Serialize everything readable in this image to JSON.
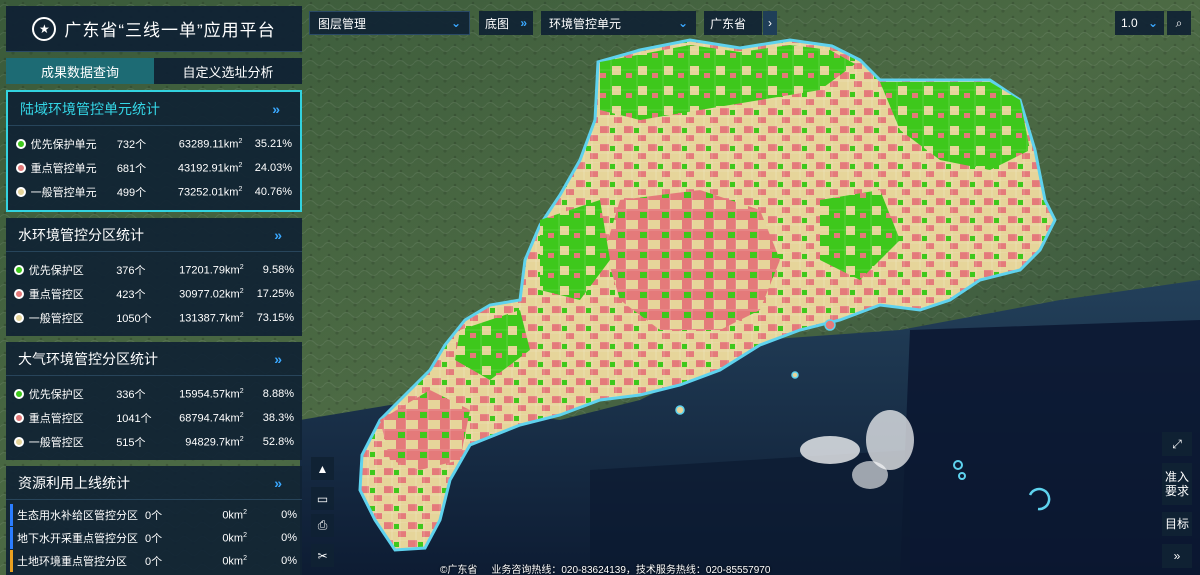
{
  "app_title": "广东省“三线一单”应用平台",
  "tabs": [
    "成果数据查询",
    "自定义选址分析"
  ],
  "colors": {
    "priority": "#3ec81c",
    "key": "#e47a7a",
    "general": "#e6d59a",
    "panel": "#102234",
    "accent": "#32d3e0"
  },
  "stats": [
    {
      "title": "陆域环境管控单元统计",
      "rows": [
        {
          "name": "优先保护单元",
          "count": "732个",
          "area": "63289.11km",
          "pct": "35.21%",
          "color": "#3ec81c"
        },
        {
          "name": "重点管控单元",
          "count": "681个",
          "area": "43192.91km",
          "pct": "24.03%",
          "color": "#e47a7a"
        },
        {
          "name": "一般管控单元",
          "count": "499个",
          "area": "73252.01km",
          "pct": "40.76%",
          "color": "#e6d59a"
        }
      ]
    },
    {
      "title": "水环境管控分区统计",
      "rows": [
        {
          "name": "优先保护区",
          "count": "376个",
          "area": "17201.79km",
          "pct": "9.58%",
          "color": "#3ec81c"
        },
        {
          "name": "重点管控区",
          "count": "423个",
          "area": "30977.02km",
          "pct": "17.25%",
          "color": "#e47a7a"
        },
        {
          "name": "一般管控区",
          "count": "1050个",
          "area": "131387.7km",
          "pct": "73.15%",
          "color": "#e6d59a"
        }
      ]
    },
    {
      "title": "大气环境管控分区统计",
      "rows": [
        {
          "name": "优先保护区",
          "count": "336个",
          "area": "15954.57km",
          "pct": "8.88%",
          "color": "#3ec81c"
        },
        {
          "name": "重点管控区",
          "count": "1041个",
          "area": "68794.74km",
          "pct": "38.3%",
          "color": "#e47a7a"
        },
        {
          "name": "一般管控区",
          "count": "515个",
          "area": "94829.7km",
          "pct": "52.8%",
          "color": "#e6d59a"
        }
      ]
    }
  ],
  "resource": {
    "title": "资源利用上线统计",
    "rows": [
      {
        "name": "生态用水补给区管控分区",
        "count": "0个",
        "area": "0km",
        "pct": "0%",
        "color": "#2b7dff"
      },
      {
        "name": "地下水开采重点管控分区",
        "count": "0个",
        "area": "0km",
        "pct": "0%",
        "color": "#2b7dff"
      },
      {
        "name": "土地环境重点管控分区",
        "count": "0个",
        "area": "0km",
        "pct": "0%",
        "color": "#e9a020"
      }
    ]
  },
  "more_glyph": "»",
  "area_sup": "2",
  "toolbar": {
    "layer_mgmt": "图层管理",
    "basemap": "底图",
    "unit_select": "环境管控单元",
    "province": "广东省",
    "zoom": "1.0"
  },
  "right_tools": {
    "access": "准入要求",
    "target": "目标"
  },
  "footer": {
    "copyright": "©广东省",
    "hotline": "业务咨询热线：020-83624139，技术服务热线：020-85557970"
  },
  "icons": [
    "compass-icon",
    "ruler-icon",
    "print-icon",
    "clear-icon",
    "expand-icon",
    "search-icon",
    "chevron-down-icon",
    "double-chevron-icon"
  ]
}
